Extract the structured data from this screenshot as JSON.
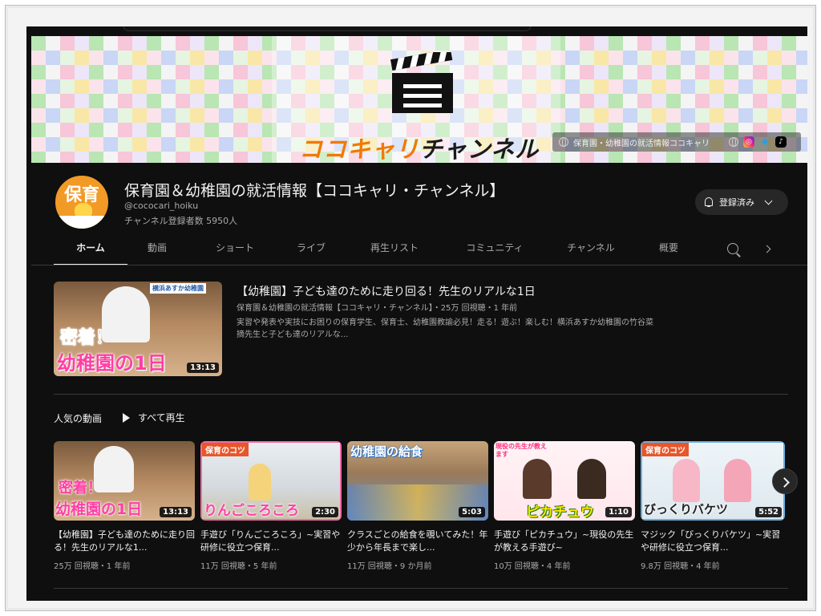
{
  "banner": {
    "brand_orange": "ココキャリ",
    "brand_dark": "チャンネル",
    "bar_text": "保育園・幼稚園の就活情報ココキャリ"
  },
  "channel": {
    "avatar_text": "保育",
    "title": "保育園＆幼稚園の就活情報【ココキャリ・チャンネル】",
    "handle": "@cococari_hoiku",
    "subscribers": "チャンネル登録者数 5950人",
    "subscribe_label": "登録済み"
  },
  "tabs": [
    "ホーム",
    "動画",
    "ショート",
    "ライブ",
    "再生リスト",
    "コミュニティ",
    "チャンネル",
    "概要"
  ],
  "featured": {
    "title": "【幼稚園】子ども達のために走り回る！先生のリアルな1日",
    "meta": "保育園＆幼稚園の就活情報【ココキャリ・チャンネル】・25万 回視聴・1 年前",
    "desc": "実習や発表や実技にお困りの保育学生、保育士、幼稚園教諭必見！走る！遊ぶ！楽しむ！横浜あすか幼稚園の竹谷菜摘先生と子ども達のリアルな...",
    "duration": "13:13",
    "thumb_caption1": "密着！",
    "thumb_caption2": "幼稚園の1日",
    "thumb_tag": "横浜あすか幼稚園"
  },
  "section": {
    "title": "人気の動画",
    "play_all": "すべて再生"
  },
  "videos": [
    {
      "title": "【幼稚園】子ども達のために走り回る！先生のリアルな1...",
      "meta": "25万 回視聴・1 年前",
      "duration": "13:13",
      "cap_top": "密着！",
      "cap_bottom": "幼稚園の1日"
    },
    {
      "title": "手遊び「りんごころころ」~実習や研修に役立つ保育...",
      "meta": "11万 回視聴・5 年前",
      "duration": "2:30",
      "cap_top": "保育のコツ",
      "cap_bottom": "りんごころころ"
    },
    {
      "title": "クラスごとの給食を覗いてみた！年少から年長まで楽し...",
      "meta": "11万 回視聴・9 か月前",
      "duration": "5:03",
      "cap_top": "幼稚園の給食",
      "cap_bottom": ""
    },
    {
      "title": "手遊び「ピカチュウ」~現役の先生が教える手遊び~",
      "meta": "10万 回視聴・4 年前",
      "duration": "1:10",
      "cap_top": "現役の先生が教えます",
      "cap_bottom": "ピカチュウ"
    },
    {
      "title": "マジック「びっくりバケツ」~実習や研修に役立つ保育...",
      "meta": "9.8万 回視聴・4 年前",
      "duration": "5:52",
      "cap_top": "保育のコツ",
      "cap_bottom": "びっくりバケツ"
    }
  ],
  "colors": {
    "background": "#0f0f0f",
    "text_primary": "#f1f1f1",
    "text_secondary": "#aaaaaa",
    "brand_orange": "#f07a00",
    "caption_pink": "#ff3fa4"
  }
}
